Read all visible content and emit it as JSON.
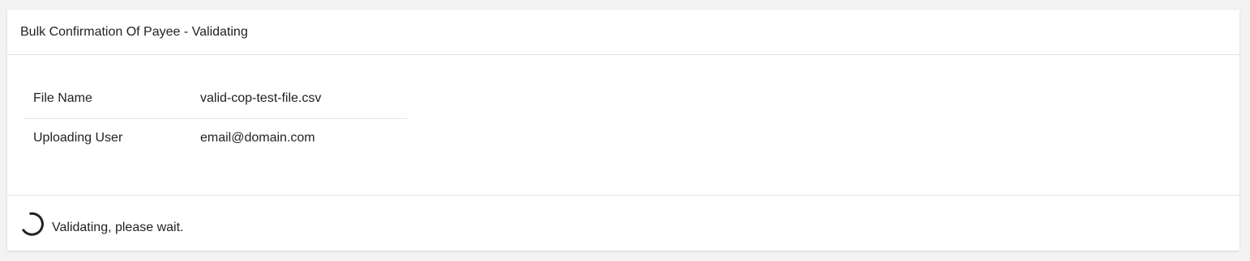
{
  "header": {
    "title": "Bulk Confirmation Of Payee - Validating"
  },
  "details": {
    "rows": [
      {
        "label": "File Name",
        "value": "valid-cop-test-file.csv"
      },
      {
        "label": "Uploading User",
        "value": "email@domain.com"
      }
    ]
  },
  "footer": {
    "status_text": "Validating, please wait.",
    "spinner_icon": "loading-spinner-icon"
  },
  "colors": {
    "background": "#f3f3f3",
    "card": "#ffffff",
    "text": "#222222",
    "divider": "#e3e3e3"
  }
}
